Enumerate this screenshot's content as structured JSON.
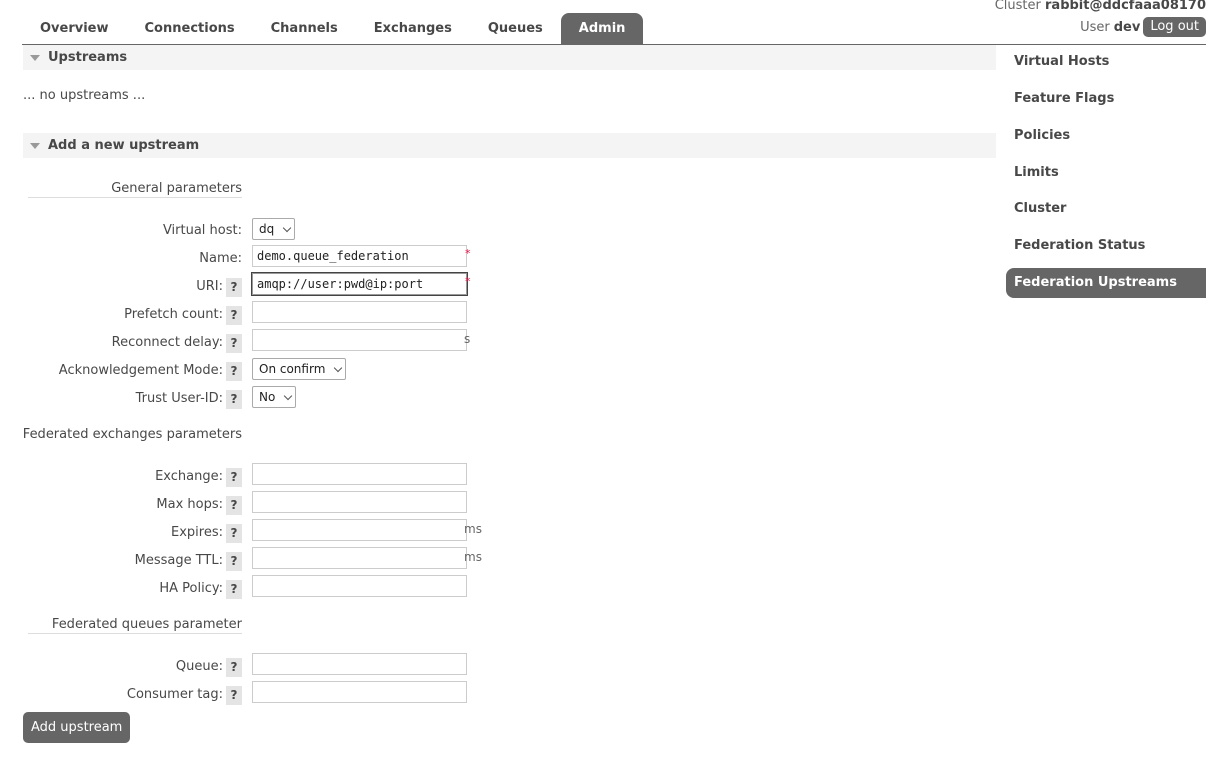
{
  "header": {
    "cluster_label": "Cluster",
    "cluster_name": "rabbit@ddcfaaa08170",
    "user_label": "User",
    "user_name": "dev",
    "logout_label": "Log out"
  },
  "nav": {
    "tabs": [
      {
        "label": "Overview"
      },
      {
        "label": "Connections"
      },
      {
        "label": "Channels"
      },
      {
        "label": "Exchanges"
      },
      {
        "label": "Queues"
      },
      {
        "label": "Admin"
      }
    ],
    "active_tab": "Admin"
  },
  "upstreams": {
    "title": "Upstreams",
    "empty_text": "... no upstreams ..."
  },
  "add_upstream": {
    "title": "Add a new upstream",
    "general": {
      "title": "General parameters",
      "virtual_host_label": "Virtual host:",
      "virtual_host_value": "dq",
      "name_label": "Name:",
      "name_value": "demo.queue_federation",
      "uri_label": "URI:",
      "uri_value": "amqp://user:pwd@ip:port",
      "prefetch_label": "Prefetch count:",
      "reconnect_label": "Reconnect delay:",
      "reconnect_unit": "s",
      "ack_mode_label": "Acknowledgement Mode:",
      "ack_mode_value": "On confirm",
      "trust_user_label": "Trust User-ID:",
      "trust_user_value": "No"
    },
    "exchanges": {
      "title": "Federated exchanges parameters",
      "exchange_label": "Exchange:",
      "max_hops_label": "Max hops:",
      "expires_label": "Expires:",
      "expires_unit": "ms",
      "message_ttl_label": "Message TTL:",
      "message_ttl_unit": "ms",
      "ha_policy_label": "HA Policy:"
    },
    "queues": {
      "title": "Federated queues parameter",
      "queue_label": "Queue:",
      "consumer_tag_label": "Consumer tag:"
    },
    "required_mark": "*",
    "help_mark": "?",
    "submit_label": "Add upstream"
  },
  "sidebar": {
    "items": [
      {
        "label": "Virtual Hosts"
      },
      {
        "label": "Feature Flags"
      },
      {
        "label": "Policies"
      },
      {
        "label": "Limits"
      },
      {
        "label": "Cluster"
      },
      {
        "label": "Federation Status"
      },
      {
        "label": "Federation Upstreams"
      }
    ],
    "active_item": "Federation Upstreams"
  },
  "colors": {
    "accent": "#666666",
    "section_bg": "#f4f4f4",
    "required": "#ee1144"
  }
}
